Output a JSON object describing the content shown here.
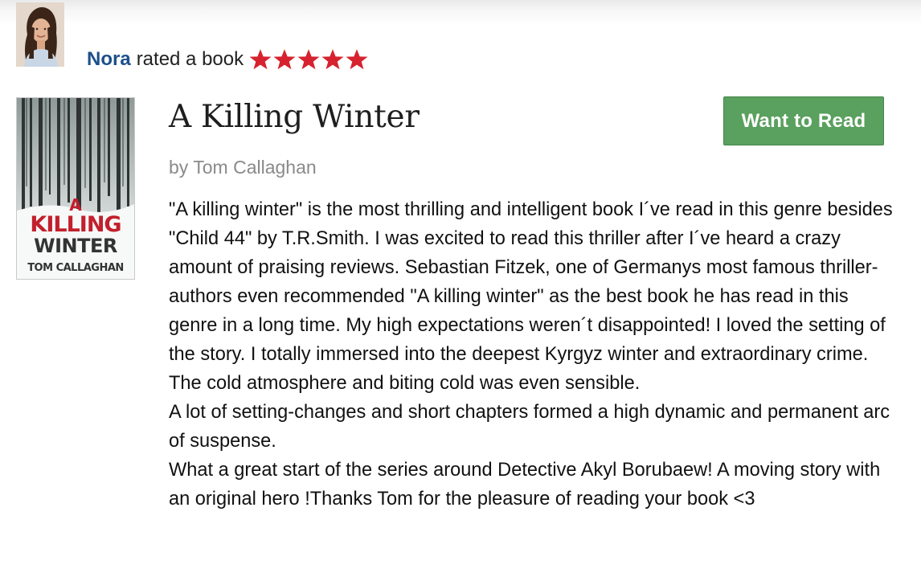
{
  "activity": {
    "user_name": "Nora",
    "action_text": "rated a book",
    "rating": 5,
    "max_rating": 5,
    "star_color": "#d6232f"
  },
  "book": {
    "title": "A Killing Winter",
    "author_line": "by Tom Callaghan",
    "cover_text": {
      "line1": "A",
      "line2": "KILLING",
      "line3": "WINTER",
      "line4": "TOM CALLAGHAN"
    }
  },
  "actions": {
    "want_to_read_label": "Want to Read",
    "button_color": "#5aa05e"
  },
  "review": {
    "paragraphs": [
      "\"A killing winter\" is the most thrilling and intelligent book I´ve read in this genre besides \"Child 44\" by T.R.Smith. I was excited to read this thriller after I´ve heard a crazy amount of praising reviews. Sebastian Fitzek, one of Germanys most famous thriller-authors even recommended \"A killing winter\" as the best book he has read in this genre in a long time. My high expectations weren´t disappointed! I loved the setting of the story. I totally immersed into the deepest Kyrgyz winter and extraordinary crime. The cold atmosphere and biting cold was even sensible.",
      "A lot of setting-changes and short chapters formed a high dynamic and permanent arc of suspense.",
      "What a great start of the series around Detective Akyl Borubaew! A moving story with an original hero !Thanks Tom for the pleasure of reading your book <3"
    ]
  }
}
